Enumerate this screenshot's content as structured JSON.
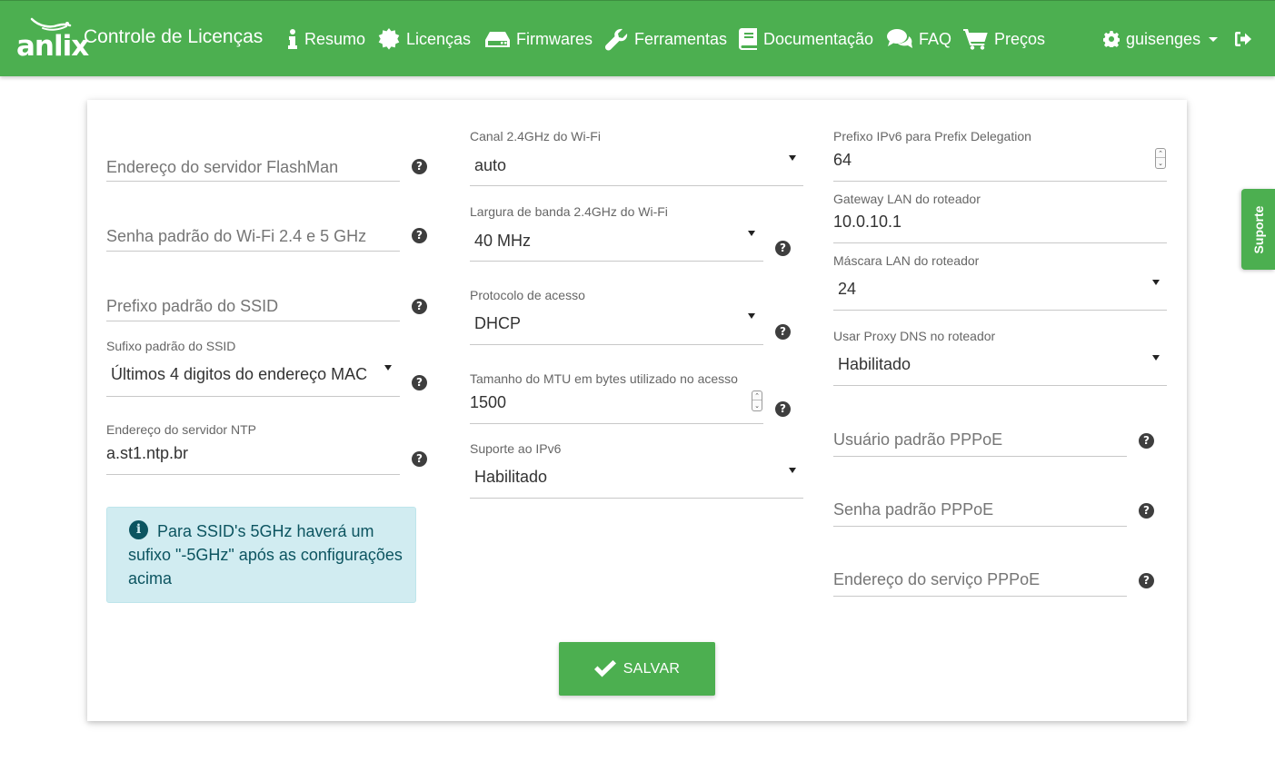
{
  "navbar": {
    "logo_text": "anlix",
    "brand_title": "Controle de Licenças",
    "items": [
      {
        "label": "Resumo",
        "icon": "info-icon"
      },
      {
        "label": "Licenças",
        "icon": "badge-icon"
      },
      {
        "label": "Firmwares",
        "icon": "hdd-icon"
      },
      {
        "label": "Ferramentas",
        "icon": "wrench-icon"
      },
      {
        "label": "Documentação",
        "icon": "book-icon"
      },
      {
        "label": "FAQ",
        "icon": "comments-icon"
      },
      {
        "label": "Preços",
        "icon": "cart-icon"
      }
    ],
    "user": {
      "label": "guisenges",
      "icon": "gear-icon"
    },
    "logout_icon": "sign-out-icon",
    "color": "#4caf50"
  },
  "form": {
    "col1": {
      "flashman_server": {
        "placeholder": "Endereço do servidor FlashMan"
      },
      "wifi_password": {
        "placeholder": "Senha padrão do Wi-Fi 2.4 e 5 GHz"
      },
      "ssid_prefix": {
        "placeholder": "Prefixo padrão do SSID"
      },
      "ssid_suffix": {
        "label": "Sufixo padrão do SSID",
        "value": "Últimos 4 digitos do endereço MAC"
      },
      "ntp_server": {
        "label": "Endereço do servidor NTP",
        "value": "a.st1.ntp.br"
      },
      "alert_text": "Para SSID's 5GHz haverá um sufixo \"-5GHz\" após as configurações acima"
    },
    "col2": {
      "wifi_channel": {
        "label": "Canal 2.4GHz do Wi-Fi",
        "value": "auto"
      },
      "wifi_bandwidth": {
        "label": "Largura de banda 2.4GHz do Wi-Fi",
        "value": "40 MHz"
      },
      "access_protocol": {
        "label": "Protocolo de acesso",
        "value": "DHCP"
      },
      "mtu": {
        "label": "Tamanho do MTU em bytes utilizado no acesso",
        "value": "1500"
      },
      "ipv6_support": {
        "label": "Suporte ao IPv6",
        "value": "Habilitado"
      }
    },
    "col3": {
      "ipv6_prefix": {
        "label": "Prefixo IPv6 para Prefix Delegation",
        "value": "64"
      },
      "lan_gateway": {
        "label": "Gateway LAN do roteador",
        "value": "10.0.10.1"
      },
      "lan_mask": {
        "label": "Máscara LAN do roteador",
        "value": "24"
      },
      "dns_proxy": {
        "label": "Usar Proxy DNS no roteador",
        "value": "Habilitado"
      },
      "pppoe_user": {
        "placeholder": "Usuário padrão PPPoE"
      },
      "pppoe_password": {
        "placeholder": "Senha padrão PPPoE"
      },
      "pppoe_service": {
        "placeholder": "Endereço do serviço PPPoE"
      }
    },
    "save_label": "SALVAR",
    "help_glyph": "?",
    "spin_up": "⌃",
    "spin_down": "⌄",
    "info_glyph": "i"
  },
  "side_tab": {
    "label": "Suporte"
  }
}
